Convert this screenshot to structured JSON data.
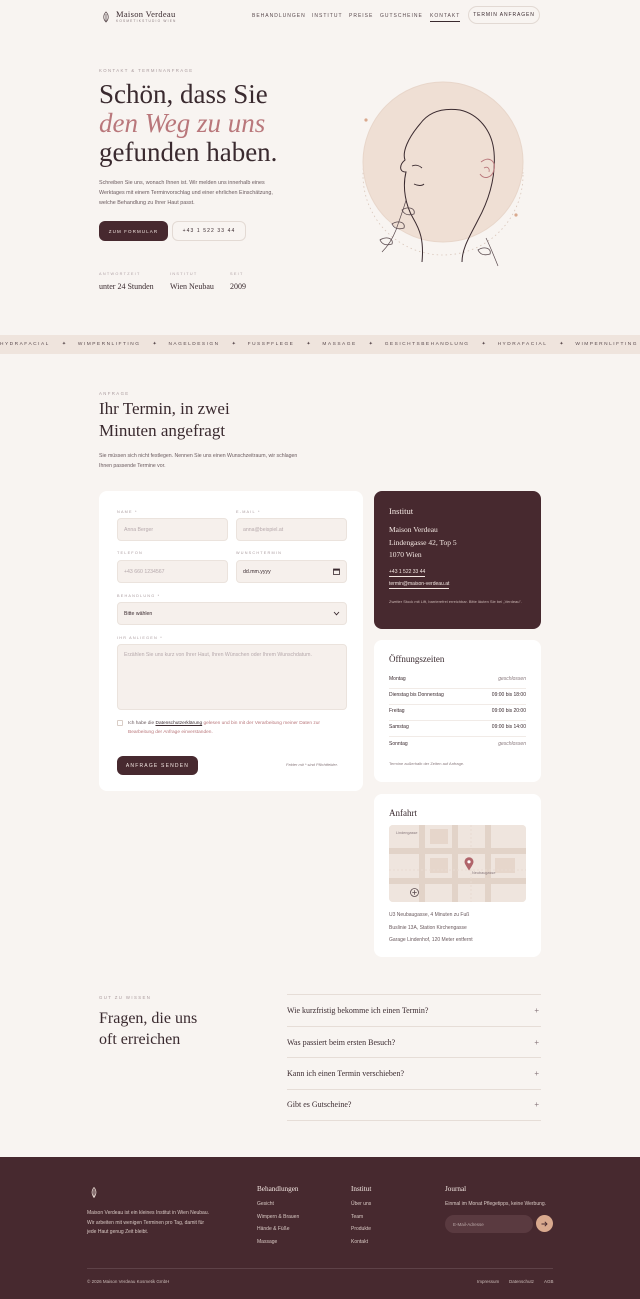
{
  "brand": {
    "name": "Maison Verdeau",
    "subtitle": "KOSMETIKSTUDIO WIEN"
  },
  "nav": {
    "items": [
      "BEHANDLUNGEN",
      "INSTITUT",
      "PREISE",
      "GUTSCHEINE",
      "KONTAKT"
    ],
    "active": "KONTAKT",
    "cta": "TERMIN ANFRAGEN"
  },
  "hero": {
    "eyebrow": "KONTAKT & TERMINANFRAGE",
    "title_line1": "Schön, dass Sie",
    "title_line2": "den Weg zu uns",
    "title_line3": "gefunden haben.",
    "text": "Schreiben Sie uns, wonach Ihnen ist. Wir melden uns innerhalb eines Werktages mit einem Terminvorschlag und einer ehrlichen Einschätzung, welche Behandlung zu Ihrer Haut passt.",
    "btn_primary": "ZUM FORMULAR",
    "btn_secondary": "+43 1 522 33 44",
    "stats": [
      {
        "label": "ANTWORTZEIT",
        "value": "unter 24 Stunden"
      },
      {
        "label": "INSTITUT",
        "value": "Wien Neubau"
      },
      {
        "label": "SEIT",
        "value": "2009"
      }
    ]
  },
  "marquee": [
    "HYDRAFACIAL",
    "WIMPERNLIFTING",
    "NAGELDESIGN",
    "FUSSPFLEGE",
    "MASSAGE",
    "GESICHTSBEHANDLUNG",
    "HYDRAFACIAL",
    "WIMPERNLIFTING"
  ],
  "form_section": {
    "eyebrow": "ANFRAGE",
    "title_line1": "Ihr Termin, in zwei",
    "title_line2": "Minuten angefragt",
    "text": "Sie müssen sich nicht festlegen. Nennen Sie uns einen Wunschzeitraum, wir schlagen Ihnen passende Termine vor."
  },
  "form": {
    "name_label": "NAME *",
    "name_placeholder": "Anna Berger",
    "email_label": "E-MAIL *",
    "email_placeholder": "anna@beispiel.at",
    "phone_label": "TELEFON",
    "phone_placeholder": "+43 660 1234567",
    "date_label": "WUNSCHTERMIN",
    "date_value": "dd.mm.yyyy",
    "treatment_label": "BEHANDLUNG *",
    "treatment_value": "Bitte wählen",
    "concern_label": "IHR ANLIEGEN *",
    "concern_placeholder": "Erzählen Sie uns kurz von Ihrer Haut, Ihren Wünschen oder Ihrem Wunschdatum.",
    "consent_pre": "Ich habe die ",
    "consent_link": "Datenschutzerklärung",
    "consent_post": " gelesen und bin mit der Verarbeitung meiner Daten zur Bearbeitung der Anfrage einverstanden.",
    "submit": "ANFRAGE SENDEN",
    "required_note": "Felder mit * sind Pflichtfelder."
  },
  "institut": {
    "title": "Institut",
    "name": "Maison Verdeau",
    "address1": "Lindengasse 42, Top 5",
    "address2": "1070 Wien",
    "phone": "+43 1 522 33 44",
    "email": "termin@maison-verdeau.at",
    "note": "Zweiter Stock mit Lift, barrierefrei erreichbar. Bitte läuten Sie bei „Verdeau\"."
  },
  "hours": {
    "title": "Öffnungszeiten",
    "rows": [
      {
        "day": "Montag",
        "time": "geschlossen"
      },
      {
        "day": "Dienstag bis Donnerstag",
        "time": "09:00 bis 18:00"
      },
      {
        "day": "Freitag",
        "time": "09:00 bis 20:00"
      },
      {
        "day": "Samstag",
        "time": "09:00 bis 14:00"
      },
      {
        "day": "Sonntag",
        "time": "geschlossen"
      }
    ],
    "note": "Termine außerhalb der Zeiten auf Anfrage."
  },
  "anfahrt": {
    "title": "Anfahrt",
    "map_label1": "Lindengasse",
    "map_label2": "Neubaugasse",
    "lines": [
      "U3 Neubaugasse, 4 Minuten zu Fuß",
      "Buslinie 13A, Station Kirchengasse",
      "Garage Lindenhof, 120 Meter entfernt"
    ]
  },
  "faq": {
    "eyebrow": "GUT ZU WISSEN",
    "title_line1": "Fragen, die uns",
    "title_line2": "oft erreichen",
    "questions": [
      "Wie kurzfristig bekomme ich einen Termin?",
      "Was passiert beim ersten Besuch?",
      "Kann ich einen Termin verschieben?",
      "Gibt es Gutscheine?"
    ]
  },
  "footer": {
    "about": "Maison Verdeau ist ein kleines Institut in Wien Neubau. Wir arbeiten mit wenigen Terminen pro Tag, damit für jede Haut genug Zeit bleibt.",
    "col1_title": "Behandlungen",
    "col1": [
      "Gesicht",
      "Wimpern & Brauen",
      "Hände & Füße",
      "Massage"
    ],
    "col2_title": "Institut",
    "col2": [
      "Über uns",
      "Team",
      "Produkte",
      "Kontakt"
    ],
    "col3_title": "Journal",
    "col3_text": "Einmal im Monat Pflegetipps, keine Werbung.",
    "newsletter_placeholder": "E-Mail-Adresse",
    "copyright": "© 2026 Maison Verdeau Kosmetik GmbH",
    "legal": [
      "Impressum",
      "Datenschutz",
      "AGB"
    ]
  },
  "colors": {
    "accent": "#b9777b",
    "dark": "#47292f",
    "background": "#f8f4f1",
    "sand": "#efe4dd",
    "peach": "#d9a98e"
  }
}
